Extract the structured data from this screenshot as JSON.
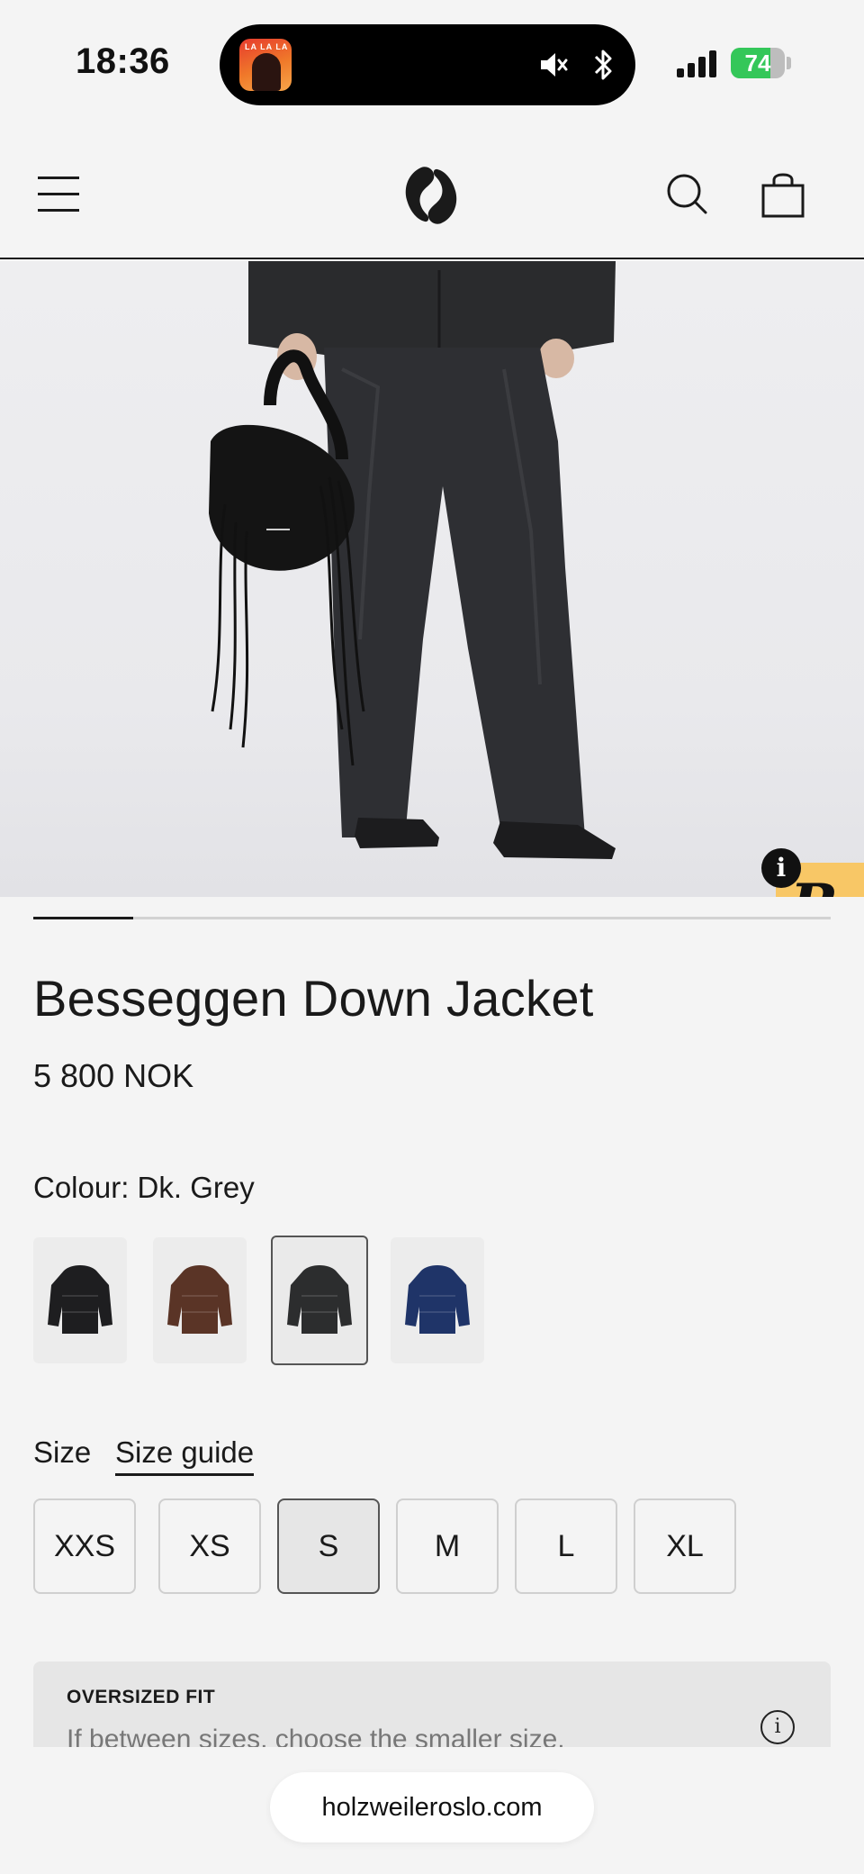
{
  "status_bar": {
    "time": "18:36",
    "now_playing_art_text": "LA LA LA",
    "battery_level": "74",
    "battery_fraction": 0.74,
    "icons": [
      "mute-icon",
      "bluetooth-icon",
      "cellular-signal-icon",
      "battery-icon"
    ]
  },
  "header": {
    "icons": [
      "menu-icon",
      "brand-logo",
      "search-icon",
      "shopping-bag-icon"
    ]
  },
  "gallery": {
    "current_index_fraction": 0.125,
    "rewards_glyph": "R",
    "rewards_info_glyph": "i"
  },
  "product": {
    "title": "Besseggen Down Jacket",
    "price": "5 800 NOK",
    "colour_label": "Colour: Dk. Grey",
    "colours": [
      {
        "name": "Black",
        "hex": "#1e1e20",
        "selected": false
      },
      {
        "name": "Brown",
        "hex": "#5a3426",
        "selected": false
      },
      {
        "name": "Dk. Grey",
        "hex": "#2c2d2e",
        "selected": true
      },
      {
        "name": "Navy",
        "hex": "#1f3468",
        "selected": false
      }
    ],
    "size_label": "Size",
    "size_guide_label": "Size guide",
    "sizes": [
      {
        "label": "XXS",
        "selected": false
      },
      {
        "label": "XS",
        "selected": false
      },
      {
        "label": "S",
        "selected": true
      },
      {
        "label": "M",
        "selected": false
      },
      {
        "label": "L",
        "selected": false
      },
      {
        "label": "XL",
        "selected": false
      }
    ],
    "fit": {
      "title": "OVERSIZED FIT",
      "text": "If between sizes, choose the smaller size.",
      "info_glyph": "i"
    }
  },
  "browser": {
    "url": "holzweileroslo.com"
  },
  "colors": {
    "background": "#f4f4f4",
    "text": "#1a1a1a",
    "rewards_badge": "#f8c766",
    "battery_green": "#34c759"
  }
}
